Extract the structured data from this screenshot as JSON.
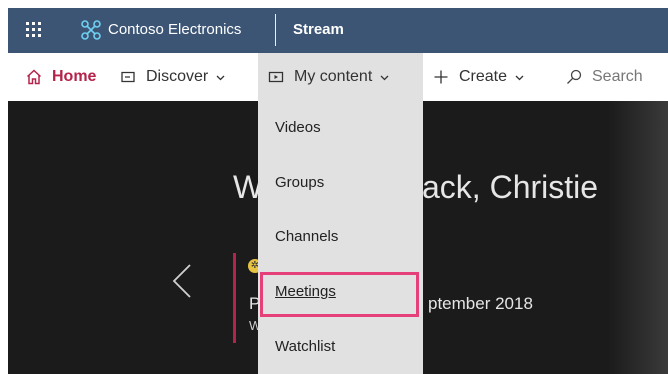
{
  "suite": {
    "org_name": "Contoso Electronics",
    "app_name": "Stream",
    "launcher_icon": "waffle-icon",
    "logo_icon": "contoso-logo"
  },
  "nav": {
    "home": "Home",
    "discover": "Discover",
    "my_content": "My content",
    "create": "Create",
    "search_placeholder": "Search",
    "accent_color": "#b4234a"
  },
  "hero": {
    "welcome_left": "W",
    "welcome_right": "ack, Christie",
    "feature_line1_start": "P",
    "feature_line1_end": "ptember 2018",
    "feature_line2_start": "W"
  },
  "my_content_menu": {
    "items": [
      "Videos",
      "Groups",
      "Channels",
      "Meetings",
      "Watchlist"
    ],
    "highlighted": "Meetings",
    "highlight_color": "#e6407a"
  }
}
